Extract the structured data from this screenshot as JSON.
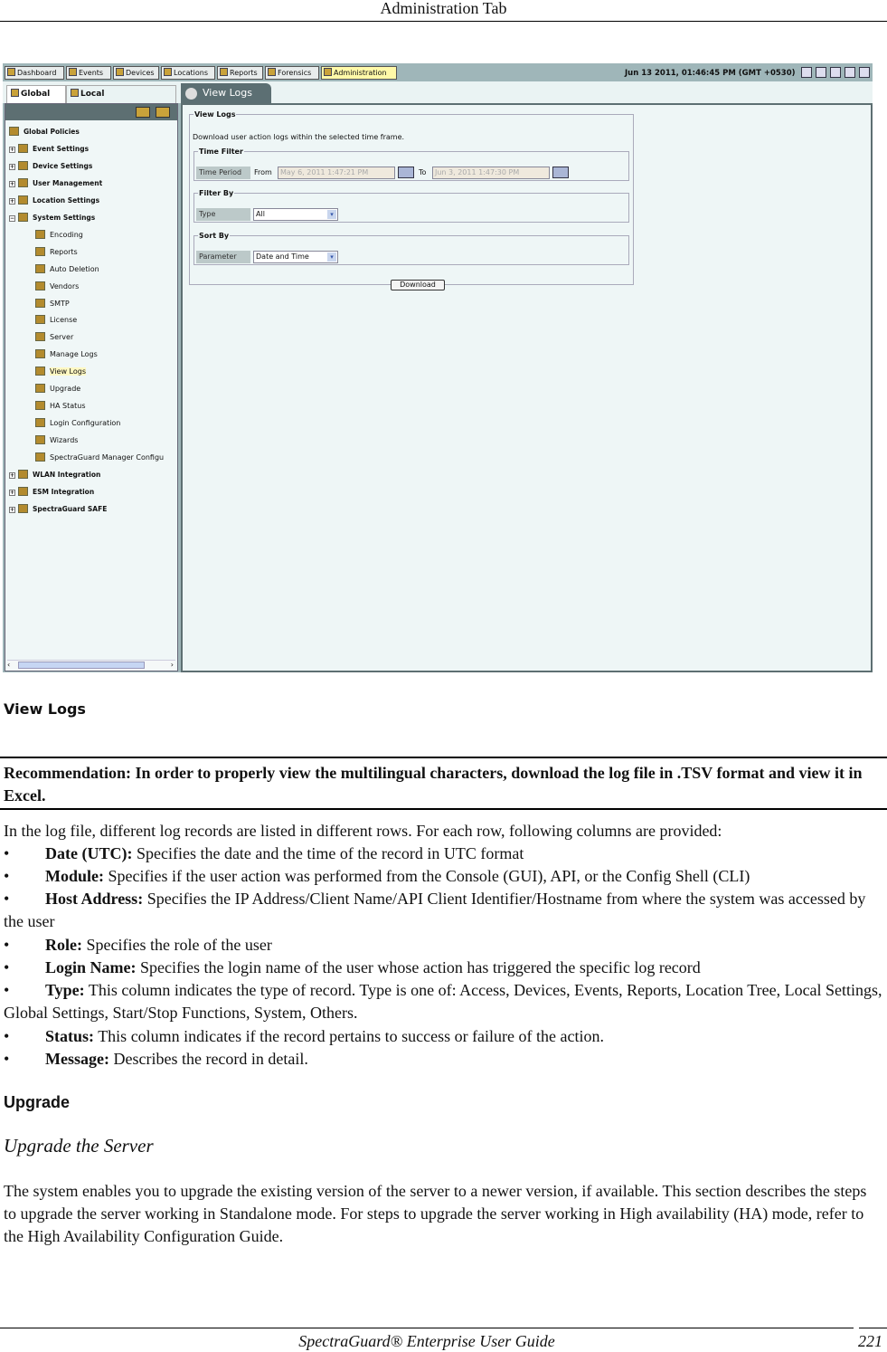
{
  "page_header": "Administration Tab",
  "app": {
    "nav": [
      {
        "label": "Dashboard",
        "icon": "dashboard-icon"
      },
      {
        "label": "Events",
        "icon": "events-icon"
      },
      {
        "label": "Devices",
        "icon": "devices-icon"
      },
      {
        "label": "Locations",
        "icon": "locations-icon"
      },
      {
        "label": "Reports",
        "icon": "reports-icon"
      },
      {
        "label": "Forensics",
        "icon": "forensics-icon"
      },
      {
        "label": "Administration",
        "icon": "administration-icon",
        "active": true
      }
    ],
    "clock": "Jun 13 2011, 01:46:45 PM (GMT +0530)",
    "toolbar_icons": [
      "refresh-icon",
      "help-icon",
      "list-icon",
      "shield-icon",
      "logout-icon"
    ],
    "left_tabs": [
      "Global",
      "Local"
    ],
    "tree": [
      {
        "label": "Global Policies",
        "level": 0,
        "bold": true
      },
      {
        "label": "Event Settings",
        "level": 1,
        "bold": true,
        "expander": "+"
      },
      {
        "label": "Device Settings",
        "level": 1,
        "bold": true,
        "expander": "+"
      },
      {
        "label": "User Management",
        "level": 1,
        "bold": true,
        "expander": "+"
      },
      {
        "label": "Location Settings",
        "level": 1,
        "bold": true,
        "expander": "+"
      },
      {
        "label": "System Settings",
        "level": 1,
        "bold": true,
        "expander": "-"
      },
      {
        "label": "Encoding",
        "level": 2
      },
      {
        "label": "Reports",
        "level": 2
      },
      {
        "label": "Auto Deletion",
        "level": 2
      },
      {
        "label": "Vendors",
        "level": 2
      },
      {
        "label": "SMTP",
        "level": 2
      },
      {
        "label": "License",
        "level": 2
      },
      {
        "label": "Server",
        "level": 2
      },
      {
        "label": "Manage Logs",
        "level": 2
      },
      {
        "label": "View Logs",
        "level": 2,
        "selected": true
      },
      {
        "label": "Upgrade",
        "level": 2
      },
      {
        "label": "HA Status",
        "level": 2
      },
      {
        "label": "Login Configuration",
        "level": 2
      },
      {
        "label": "Wizards",
        "level": 2
      },
      {
        "label": "SpectraGuard Manager Configu",
        "level": 2
      },
      {
        "label": "WLAN Integration",
        "level": 1,
        "bold": true,
        "expander": "+"
      },
      {
        "label": "ESM Integration",
        "level": 1,
        "bold": true,
        "expander": "+"
      },
      {
        "label": "SpectraGuard SAFE",
        "level": 1,
        "bold": true,
        "expander": "+"
      }
    ],
    "panel": {
      "tab_title": "View Logs",
      "group_title": "View Logs",
      "description": "Download user action logs within the selected time frame.",
      "time_filter": {
        "legend": "Time Filter",
        "label": "Time Period",
        "from_label": "From",
        "from_value": "May 6, 2011 1:47:21 PM",
        "to_label": "To",
        "to_value": "Jun 3, 2011 1:47:30 PM"
      },
      "filter_by": {
        "legend": "Filter By",
        "label": "Type",
        "value": "All"
      },
      "sort_by": {
        "legend": "Sort By",
        "label": "Parameter",
        "value": "Date and Time"
      },
      "download_label": "Download"
    }
  },
  "caption": "View Logs",
  "recommendation": "Recommendation: In order to properly view the multilingual characters, download the log file in .TSV format and view it in Excel.",
  "intro": "In the log file, different log records are listed in different rows. For each row, following columns are provided:",
  "columns": [
    {
      "term": "Date (UTC):",
      "desc": " Specifies the date and the time of the record in UTC format"
    },
    {
      "term": "Module:",
      "desc": " Specifies if the user action was performed from the Console (GUI), API, or the Config Shell (CLI)"
    },
    {
      "term": "Host Address:",
      "desc": " Specifies the IP Address/Client Name/API Client Identifier/Hostname from where the system was accessed by the user"
    },
    {
      "term": "Role:",
      "desc": " Specifies the role of the user"
    },
    {
      "term": "Login Name:",
      "desc": " Specifies the login name of the user whose action has triggered the specific log record"
    },
    {
      "term": "Type:",
      "desc": " This column indicates the type of record. Type is one of: Access, Devices, Events, Reports, Location Tree, Local Settings, Global Settings, Start/Stop Functions, System, Others."
    },
    {
      "term": "Status:",
      "desc": " This column indicates if the record pertains to success or failure of the action."
    },
    {
      "term": "Message:",
      "desc": " Describes the record in detail."
    }
  ],
  "upgrade_heading": "Upgrade",
  "upgrade_subheading": "Upgrade the Server",
  "upgrade_text": "The system enables you to upgrade the existing version of the server to a newer version, if available. This section describes the steps to upgrade the server working in Standalone mode. For steps to upgrade the server working in High availability (HA) mode, refer to the High Availability Configuration Guide.",
  "footer": {
    "title": "SpectraGuard® Enterprise User Guide",
    "page": "221"
  }
}
